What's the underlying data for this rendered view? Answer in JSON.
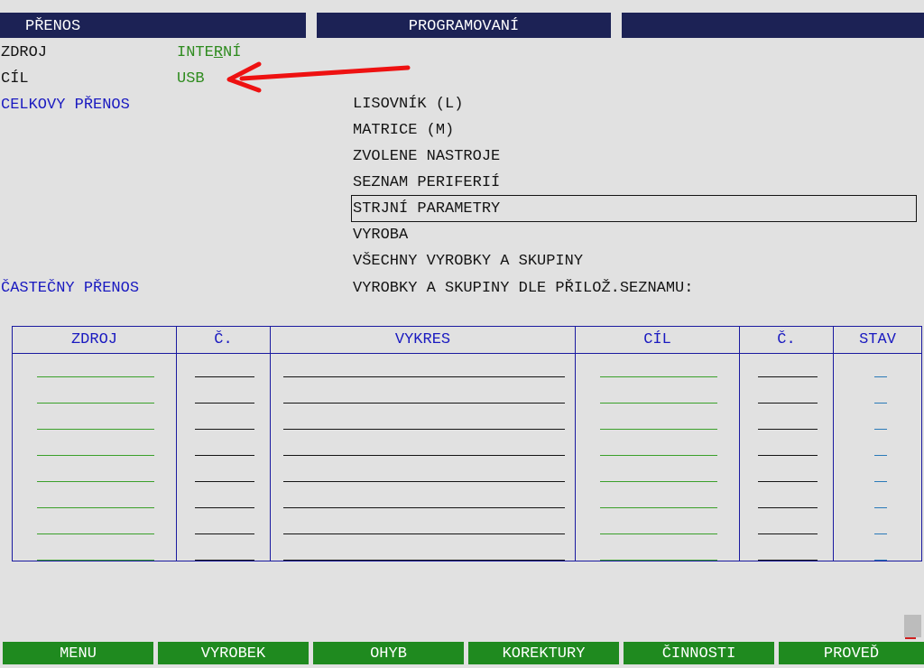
{
  "header": {
    "left": "PŘENOS",
    "center": "PROGRAMOVANÍ",
    "right": ""
  },
  "settings": {
    "source_label": "ZDROJ",
    "source_value_pre": "INTE",
    "source_value_ul": "R",
    "source_value_post": "NÍ",
    "target_label": "CÍL",
    "target_value": "USB"
  },
  "full_transfer_label": "CELKOVY PŘENOS",
  "partial_transfer_label": "ČASTEČNY PŘENOS",
  "transfer_items": [
    "LISOVNÍK (L)",
    "MATRICE (M)",
    "ZVOLENE NASTROJE",
    "SEZNAM PERIFERIÍ",
    "STRJNÍ PARAMETRY",
    "VYROBA",
    "VŠECHNY VYROBKY A SKUPINY",
    "VYROBKY A SKUPINY DLE PŘILOŽ.SEZNAMU:"
  ],
  "selected_item": "STRJNÍ PARAMETRY",
  "table": {
    "columns": [
      "ZDROJ",
      "Č.",
      "VYKRES",
      "CÍL",
      "Č.",
      "STAV"
    ],
    "rows": [
      [
        "",
        "",
        "",
        "",
        "",
        ""
      ],
      [
        "",
        "",
        "",
        "",
        "",
        ""
      ],
      [
        "",
        "",
        "",
        "",
        "",
        ""
      ],
      [
        "",
        "",
        "",
        "",
        "",
        ""
      ],
      [
        "",
        "",
        "",
        "",
        "",
        ""
      ],
      [
        "",
        "",
        "",
        "",
        "",
        ""
      ],
      [
        "",
        "",
        "",
        "",
        "",
        ""
      ],
      [
        "",
        "",
        "",
        "",
        "",
        ""
      ]
    ]
  },
  "function_keys": [
    "MENU",
    "VYROBEK",
    "OHYB",
    "KOREKTURY",
    "ČINNOSTI",
    "PROVEĎ"
  ],
  "colors": {
    "title_bar": "#1c2255",
    "value_green": "#2e8b1e",
    "heading_blue": "#1a1ac0",
    "fkey_green": "#1f8a1f",
    "arrow_red": "#ee1111"
  }
}
